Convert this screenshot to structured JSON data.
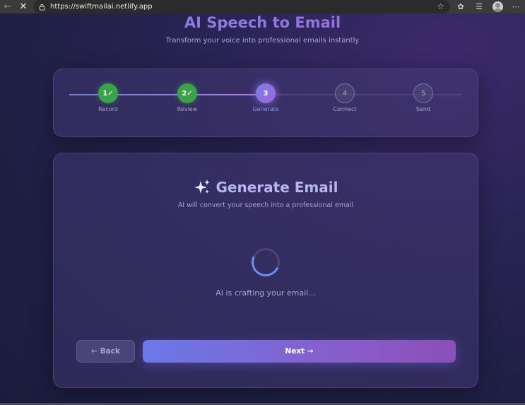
{
  "browser": {
    "url": "https://swiftmailai.netlify.app"
  },
  "hero": {
    "title": "AI Speech to Email",
    "subtitle": "Transform your voice into professional emails instantly"
  },
  "steps": [
    {
      "marker": "1✓",
      "label": "Record",
      "state": "done"
    },
    {
      "marker": "2✓",
      "label": "Review",
      "state": "done"
    },
    {
      "marker": "3",
      "label": "Generate",
      "state": "active"
    },
    {
      "marker": "4",
      "label": "Connect",
      "state": "pending"
    },
    {
      "marker": "5",
      "label": "Send",
      "state": "pending"
    }
  ],
  "main": {
    "title": "Generate Email",
    "title_icon": "sparkles-icon",
    "subtitle": "AI will convert your speech into a professional email",
    "status": "AI is crafting your email...",
    "back_label": "← Back",
    "next_label": "Next →"
  },
  "colors": {
    "done": "#3aa249",
    "active": "#8a74e0",
    "accent_start": "#6b79e8",
    "accent_end": "#8a4fb8"
  }
}
